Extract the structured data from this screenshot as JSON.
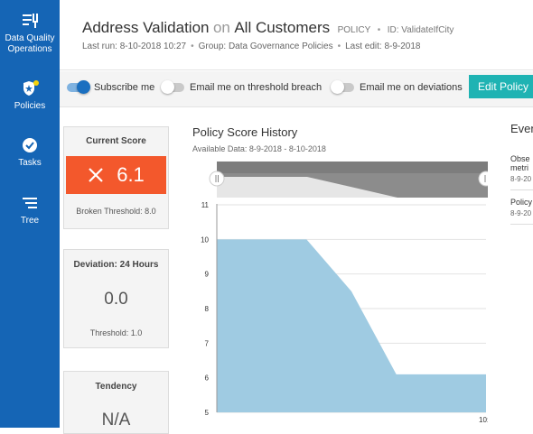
{
  "sidebar": {
    "items": [
      {
        "label_line1": "Data Quality",
        "label_line2": "Operations",
        "icon": "data-quality-icon"
      },
      {
        "label": "Policies",
        "icon": "shield-badge-icon"
      },
      {
        "label": "Tasks",
        "icon": "check-circle-icon"
      },
      {
        "label": "Tree",
        "icon": "tree-list-icon"
      }
    ]
  },
  "header": {
    "title": "Address Validation",
    "on_word": "on",
    "target": "All Customers",
    "type": "POLICY",
    "id_text": "ID: ValidateIfCity",
    "last_run": "Last run: 8-10-2018 10:27",
    "group": "Group: Data Governance Policies",
    "last_edit": "Last edit: 8-9-2018"
  },
  "toolbar": {
    "subscribe": {
      "label": "Subscribe me",
      "on": true
    },
    "threshold": {
      "label": "Email me on threshold breach",
      "on": false
    },
    "deviations": {
      "label": "Email me on deviations",
      "on": false
    },
    "edit_label": "Edit Policy"
  },
  "cards": {
    "current": {
      "title": "Current Score",
      "value": "6.1",
      "foot": "Broken Threshold: 8.0"
    },
    "deviation": {
      "title": "Deviation: 24 Hours",
      "value": "0.0",
      "foot": "Threshold: 1.0"
    },
    "tendency": {
      "title": "Tendency",
      "value": "N/A"
    }
  },
  "chart_panel": {
    "title": "Policy Score History",
    "available": "Available Data: 8-9-2018 - 8-10-2018"
  },
  "events": {
    "title": "Even",
    "items": [
      {
        "line1": "Obse",
        "line2": "metri",
        "date": "8-9-20"
      },
      {
        "line1": "Policy",
        "date": "8-9-20"
      }
    ]
  },
  "chart_data": {
    "type": "area",
    "x": [
      0,
      0.5,
      1,
      1.5,
      2,
      2.5,
      3
    ],
    "y": [
      10,
      10,
      10,
      8.5,
      6.1,
      6.1,
      6.1
    ],
    "yticks": [
      "11",
      "10",
      "9",
      "8",
      "7",
      "6",
      "5"
    ],
    "ylim": [
      5,
      11
    ],
    "xtick_label": "10:",
    "fill_color": "#9fcbe2",
    "grid": true
  }
}
